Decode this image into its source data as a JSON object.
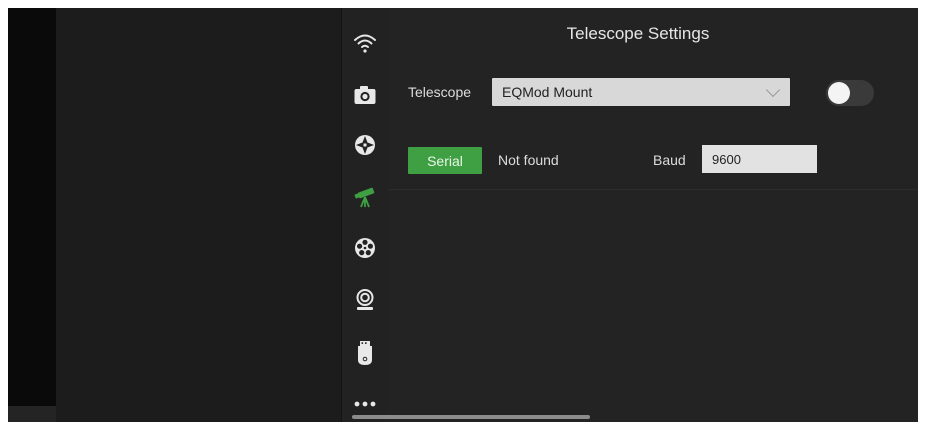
{
  "panel": {
    "title": "Telescope Settings",
    "telescope_label": "Telescope",
    "telescope_select": "EQMod Mount",
    "connection_toggle_on": false,
    "serial_button": "Serial",
    "serial_status": "Not found",
    "baud_label": "Baud",
    "baud_value": "9600"
  },
  "rail": {
    "items": [
      {
        "icon": "wifi-icon",
        "active": false
      },
      {
        "icon": "camera-icon",
        "active": false
      },
      {
        "icon": "focus-target-icon",
        "active": false
      },
      {
        "icon": "telescope-icon",
        "active": true
      },
      {
        "icon": "filter-wheel-icon",
        "active": false
      },
      {
        "icon": "webcam-icon",
        "active": false
      },
      {
        "icon": "storage-device-icon",
        "active": false
      },
      {
        "icon": "more-icon",
        "active": false
      }
    ]
  },
  "colors": {
    "accent_green": "#3fa043",
    "panel_bg": "#232323",
    "rail_bg": "#222222",
    "icon_default": "#e8e8e8"
  }
}
